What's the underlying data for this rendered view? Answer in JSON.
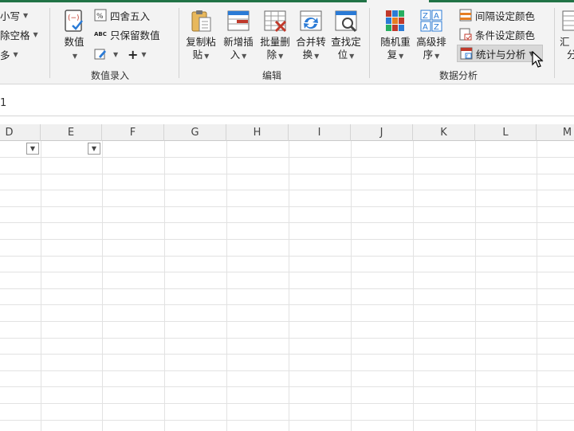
{
  "ribbon": {
    "left_group": {
      "items": [
        {
          "label": "小写",
          "dropdown": true
        },
        {
          "label": "除空格",
          "dropdown": true
        },
        {
          "label": "多",
          "dropdown": true
        }
      ]
    },
    "data_entry": {
      "label": "数值录入",
      "value_button": {
        "label": "数值"
      },
      "round_button": {
        "label": "四舍五入",
        "icon": "percent-icon"
      },
      "keep_value_button": {
        "label": "只保留数值",
        "icon_text": "ABC"
      },
      "edit_button": {
        "icon": "edit-icon"
      },
      "add_button": {
        "label": "+"
      }
    },
    "edit": {
      "label": "编辑",
      "buttons": [
        {
          "line1": "复制粘",
          "line2": "贴",
          "icon": "copy-paste-icon"
        },
        {
          "line1": "新增插",
          "line2": "入",
          "icon": "insert-icon"
        },
        {
          "line1": "批量删",
          "line2": "除",
          "icon": "batch-delete-icon"
        },
        {
          "line1": "合并转",
          "line2": "换",
          "icon": "merge-convert-icon"
        },
        {
          "line1": "查找定",
          "line2": "位",
          "icon": "find-locate-icon"
        }
      ]
    },
    "analysis": {
      "label": "数据分析",
      "buttons": [
        {
          "line1": "随机重",
          "line2": "复",
          "icon": "random-repeat-icon"
        },
        {
          "line1": "高级排",
          "line2": "序",
          "icon": "advanced-sort-icon"
        }
      ],
      "small_items": [
        {
          "label": "间隔设定颜色",
          "icon": "interval-color-icon"
        },
        {
          "label": "条件设定颜色",
          "icon": "condition-color-icon"
        },
        {
          "label": "统计与分析",
          "icon": "statistics-icon",
          "dropdown": true,
          "highlighted": true
        }
      ]
    },
    "summary": {
      "line1": "汇",
      "line2": "分"
    }
  },
  "formula_bar": {
    "name_fragment": "1"
  },
  "sheet": {
    "columns": [
      "D",
      "E",
      "F",
      "G",
      "H",
      "I",
      "J",
      "K",
      "L",
      "M"
    ],
    "filter_columns": [
      "D",
      "E"
    ]
  },
  "colors": {
    "accent_green": "#217346",
    "highlight": "#d8d8d8"
  }
}
